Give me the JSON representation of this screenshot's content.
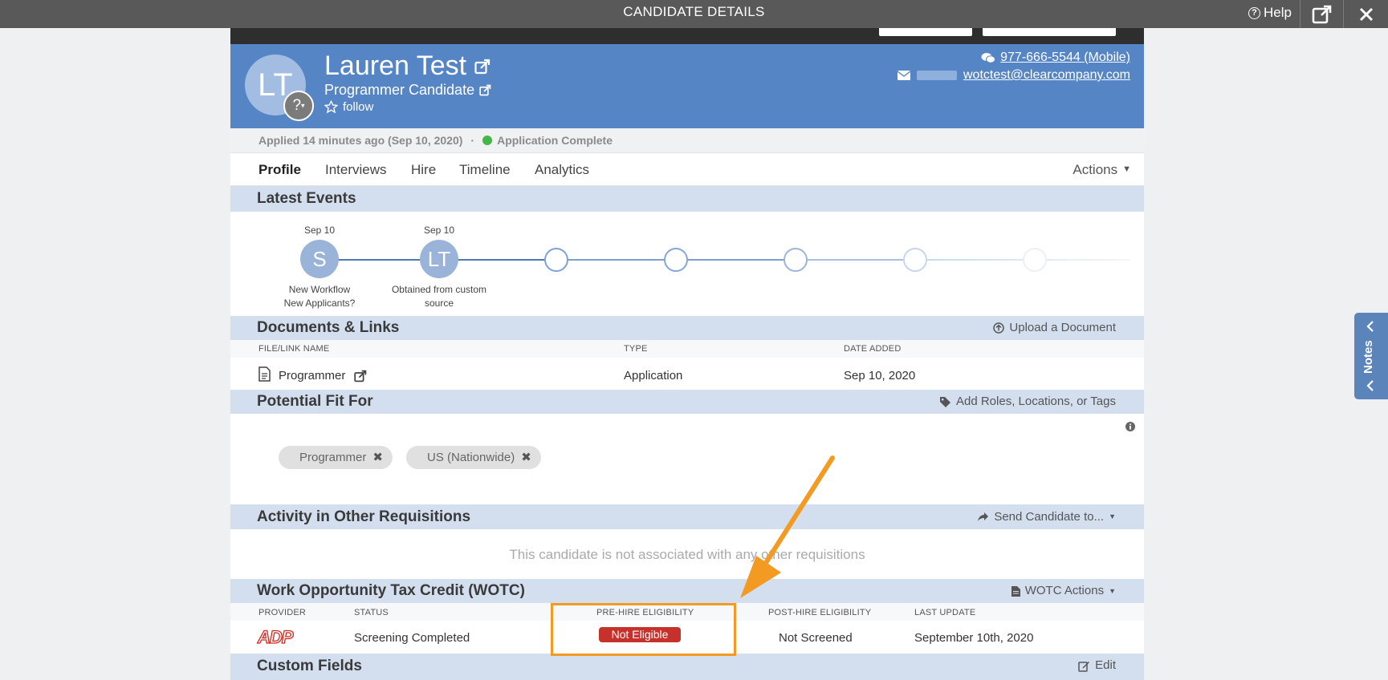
{
  "modal": {
    "title": "CANDIDATE DETAILS",
    "help_label": "Help"
  },
  "candidate": {
    "initials": "LT",
    "avatar_menu_glyph": "?",
    "name": "Lauren Test",
    "role": "Programmer Candidate",
    "follow_label": "follow",
    "phone": "977-666-5544 (Mobile)",
    "email": "wotctest@clearcompany.com"
  },
  "status": {
    "applied": "Applied 14 minutes ago (Sep 10, 2020)",
    "separator": "·",
    "application": "Application Complete"
  },
  "tabs": {
    "items": [
      "Profile",
      "Interviews",
      "Hire",
      "Timeline",
      "Analytics"
    ],
    "actions_label": "Actions"
  },
  "latest_events": {
    "title": "Latest Events",
    "events": [
      {
        "date": "Sep 10",
        "initial": "S",
        "caption_1": "New Workflow",
        "caption_2": "New Applicants?"
      },
      {
        "date": "Sep 10",
        "initial": "LT",
        "caption_1": "Obtained from custom",
        "caption_2": "source"
      }
    ]
  },
  "documents": {
    "title": "Documents & Links",
    "upload_label": "Upload a Document",
    "columns": [
      "FILE/LINK NAME",
      "TYPE",
      "DATE ADDED"
    ],
    "rows": [
      {
        "name": "Programmer",
        "type": "Application",
        "date": "Sep 10, 2020"
      }
    ]
  },
  "potential_fit": {
    "title": "Potential Fit For",
    "add_label": "Add Roles, Locations, or Tags",
    "chips": [
      "Programmer",
      "US (Nationwide)"
    ]
  },
  "activity": {
    "title": "Activity in Other Requisitions",
    "send_label": "Send Candidate to...",
    "empty_text": "This candidate is not associated with any other requisitions"
  },
  "wotc": {
    "title": "Work Opportunity Tax Credit (WOTC)",
    "actions_label": "WOTC Actions",
    "columns": [
      "PROVIDER",
      "STATUS",
      "PRE-HIRE ELIGIBILITY",
      "POST-HIRE ELIGIBILITY",
      "LAST UPDATE"
    ],
    "row": {
      "provider_logo_text": "ADP",
      "status": "Screening Completed",
      "pre_hire": "Not Eligible",
      "post_hire": "Not Screened",
      "last_update": "September 10th, 2020"
    }
  },
  "custom_fields": {
    "title": "Custom Fields",
    "edit_label": "Edit"
  },
  "notes_panel": {
    "label": "Notes"
  },
  "colors": {
    "header_blue": "#5585c5",
    "section_blue": "#d3dfef",
    "badge_red": "#c6312c",
    "highlight_orange": "#f39a22",
    "status_green": "#45b649"
  }
}
